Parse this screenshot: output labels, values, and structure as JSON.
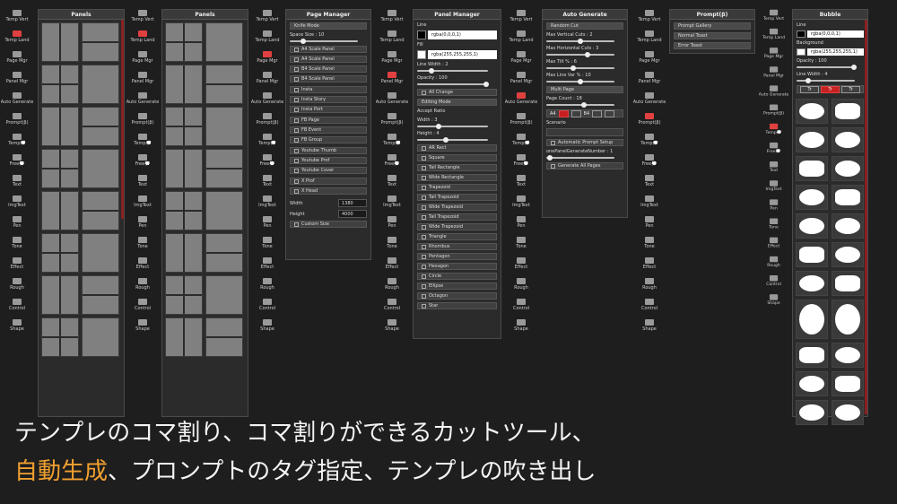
{
  "toolbar": [
    {
      "label": "Temp Vert",
      "icon": "temp-vert-icon"
    },
    {
      "label": "Temp Land",
      "icon": "temp-land-icon"
    },
    {
      "label": "Page Mgr",
      "icon": "page-mgr-icon"
    },
    {
      "label": "Panel Mgr",
      "icon": "panel-mgr-icon"
    },
    {
      "label": "Auto Generate",
      "icon": "auto-generate-icon"
    },
    {
      "label": "Prompt(β)",
      "icon": "prompt-icon"
    },
    {
      "label": "Temp💭",
      "icon": "temp-bubble-icon"
    },
    {
      "label": "Free💭",
      "icon": "free-bubble-icon"
    },
    {
      "label": "Text",
      "icon": "text-icon"
    },
    {
      "label": "ImgText",
      "icon": "imgtext-icon"
    },
    {
      "label": "Pen",
      "icon": "pen-icon"
    },
    {
      "label": "Tone",
      "icon": "tone-icon"
    },
    {
      "label": "Effect",
      "icon": "effect-icon"
    },
    {
      "label": "Rough",
      "icon": "rough-icon"
    },
    {
      "label": "Control",
      "icon": "control-icon"
    },
    {
      "label": "Shape",
      "icon": "shape-icon"
    }
  ],
  "panels_title": "Panels",
  "page_manager": {
    "title": "Page Manager",
    "knife_mode": "Knife Mode",
    "space_size": "Space Size : 10",
    "sizes": [
      "A4 Scale Panel",
      "A4 Scale Panel",
      "B4 Scale Panel",
      "B4 Scale Panel"
    ],
    "insta": [
      "Insta",
      "Insta Story",
      "Insta Port"
    ],
    "fb": [
      "FB Page",
      "FB Event",
      "FB Group"
    ],
    "youtube": [
      "Youtube Thumb",
      "Youtube Prof",
      "Youtube Cover"
    ],
    "x": [
      "X Prof",
      "X Head"
    ],
    "width_label": "Width",
    "width_value": "1380",
    "height_label": "Height",
    "height_value": "4000",
    "custom_size": "Custom Size"
  },
  "panel_manager": {
    "title": "Panel Manager",
    "line_label": "Line",
    "line_color": "rgba(0,0,0,1)",
    "fill_label": "Fill",
    "fill_color": "rgba(255,255,255,1)",
    "line_width": "Line Width : 2",
    "opacity": "Opacity : 100",
    "all_change": "All Change",
    "editing_mode": "Editing Mode",
    "accept_ratio": "Accept Ratio",
    "width": "Width : 3",
    "height": "Height : 4",
    "shapes": [
      "AR Rect",
      "Square",
      "Tall Rectangle",
      "Wide Rectangle",
      "Trapezoid",
      "Tall Trapezoid",
      "Wide Trapezoid",
      "Tall Trapezoid",
      "Wide Trapezoid",
      "Triangle",
      "Rhombus",
      "Pentagon",
      "Hexagon",
      "Circle",
      "Ellipse",
      "Octagon",
      "Star"
    ]
  },
  "auto_generate": {
    "title": "Auto Generate",
    "random_cut": "Random Cut",
    "sliders": [
      {
        "label": "Max Vertical Cuts : 2",
        "value": 0.5
      },
      {
        "label": "Max Horizontal Cuts : 3",
        "value": 0.6
      },
      {
        "label": "Max Tilt % : 6",
        "value": 0.4
      },
      {
        "label": "Max Line Var % : 10",
        "value": 0.5
      }
    ],
    "multi_page": "Multi Page",
    "page_count": "Page Count : 18",
    "page_count_value": 0.55,
    "a4": "A4",
    "b4": "B4",
    "scenario": "Scenario",
    "auto_prompt": "Automatic Prompt Setup",
    "one_panel": "onePanelGenerateNumber : 1",
    "generate_all": "Generate All Pages"
  },
  "prompt": {
    "title": "Prompt(β)",
    "items": [
      "Prompt Gallery",
      "Normal Toast",
      "Error Toast"
    ]
  },
  "bubble": {
    "title": "Bubble",
    "line_label": "Line",
    "line_color": "rgba(0,0,0,1)",
    "bg_label": "Background",
    "bg_color": "rgba(255,255,255,1)",
    "opacity": "Opacity : 100",
    "line_width": "Line Width : 4",
    "tail_buttons": [
      "Tr",
      "Tr",
      "Tr"
    ]
  },
  "caption": {
    "line1": "テンプレのコマ割り、コマ割りができるカットツール、",
    "line2_accent": "自動生成",
    "line2_rest": "、プロンプトのタグ指定、テンプレの吹き出し",
    "accent_color": "#f0a030"
  }
}
